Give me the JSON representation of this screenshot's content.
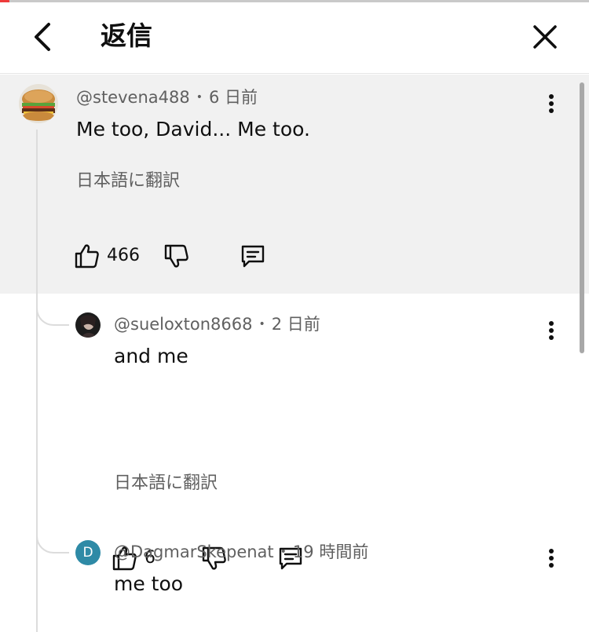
{
  "header": {
    "title": "返信",
    "back_icon": "chevron-left-icon",
    "close_icon": "close-icon"
  },
  "comments": [
    {
      "handle": "@stevena488",
      "time": "6 日前",
      "text": "Me too, David... Me too.",
      "translate_label": "日本語に翻訳",
      "likes": "466",
      "avatar": "burger-avatar",
      "highlighted": true
    },
    {
      "handle": "@sueloxton8668",
      "time": "2 日前",
      "text": "and me",
      "translate_label": "日本語に翻訳",
      "likes": "6",
      "avatar": "photo-avatar"
    },
    {
      "handle": "@DagmarSkepenat",
      "time": "19 時間前",
      "text": "me too",
      "avatar_letter": "D",
      "avatar_color": "#2e8aa6"
    }
  ],
  "meta_separator": "•",
  "colors": {
    "highlight_bg": "#f1f1f1",
    "secondary_text": "#606060",
    "record_dot": "#ee3b3b"
  }
}
